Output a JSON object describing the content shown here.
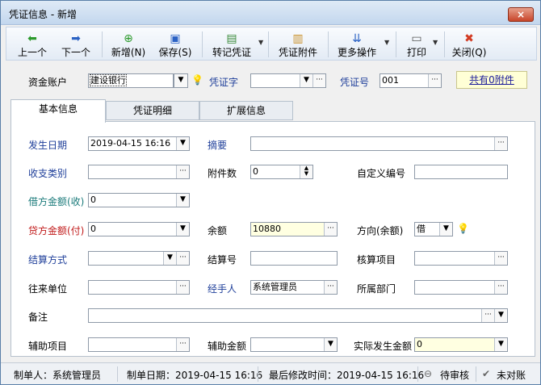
{
  "window": {
    "title": "凭证信息 - 新增",
    "close": "×"
  },
  "toolbar": {
    "prev": "上一个",
    "next": "下一个",
    "add": "新增(N)",
    "save": "保存(S)",
    "post": "转记凭证",
    "attach": "凭证附件",
    "more": "更多操作",
    "print": "打印",
    "close": "关闭(Q)",
    "prev_icon": "⬅",
    "next_icon": "➡",
    "add_icon": "⊕",
    "save_icon": "▣",
    "post_icon": "▤",
    "attach_icon": "▥",
    "more_icon": "⇊",
    "print_icon": "▭",
    "close_icon": "✖"
  },
  "header": {
    "account_label": "资金账户",
    "account_value": "建设银行",
    "voucher_word_label": "凭证字",
    "voucher_word_value": "",
    "voucher_no_label": "凭证号",
    "voucher_no_value": "001",
    "attach_count": "共有0附件"
  },
  "tabs": [
    "基本信息",
    "凭证明细",
    "扩展信息"
  ],
  "form": {
    "date_label": "发生日期",
    "date_value": "2019-04-15 16:16",
    "summary_label": "摘要",
    "summary_value": "",
    "category_label": "收支类别",
    "category_value": "",
    "attach_num_label": "附件数",
    "attach_num_value": "0",
    "custom_no_label": "自定义编号",
    "custom_no_value": "",
    "debit_label": "借方金额(收)",
    "debit_value": "0",
    "credit_label": "贷方金额(付)",
    "credit_value": "0",
    "balance_label": "余额",
    "balance_value": "10880",
    "direction_label": "方向(余额)",
    "direction_value": "借",
    "settle_label": "结算方式",
    "settle_value": "",
    "settle_no_label": "结算号",
    "settle_no_value": "",
    "acct_item_label": "核算项目",
    "acct_item_value": "",
    "partner_label": "往来单位",
    "partner_value": "",
    "handler_label": "经手人",
    "handler_value": "系统管理员",
    "dept_label": "所属部门",
    "dept_value": "",
    "remark_label": "备注",
    "remark_value": "",
    "aux_item_label": "辅助项目",
    "aux_item_value": "",
    "aux_amount_label": "辅助金额",
    "aux_amount_value": "",
    "actual_label": "实际发生金额",
    "actual_value": "0"
  },
  "status": {
    "maker": "制单人：系统管理员",
    "make_date": "制单日期：2019-04-15 16:16",
    "modified": "最后修改时间：2019-04-15 16:16",
    "review": "待审核",
    "reconcile": "未对账",
    "review_icon": "⊖",
    "reconcile_icon": "✔"
  }
}
